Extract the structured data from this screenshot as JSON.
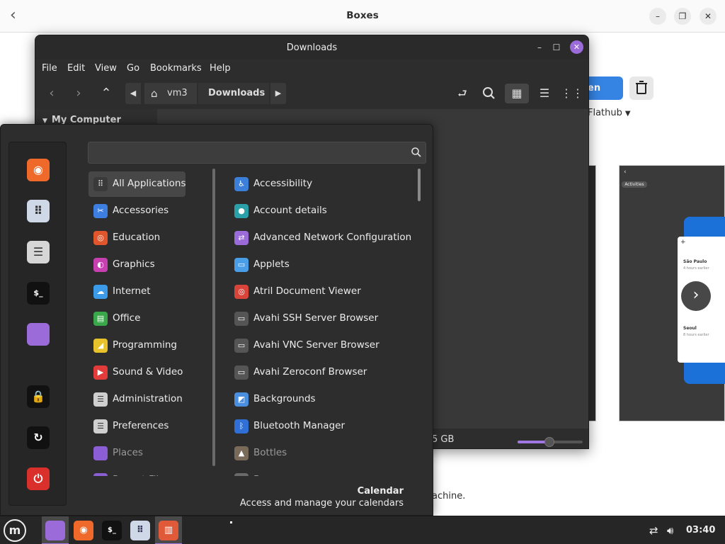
{
  "boxes": {
    "title": "Boxes",
    "open_label": "en",
    "source_label": "Flathub",
    "activities_label": "Activities",
    "city1": "São Paulo",
    "city1_sub": "4 hours earlier",
    "city2": "Seoul",
    "city2_sub": "8 hours earlier",
    "desc_fragment": "achine."
  },
  "nemo": {
    "title": "Downloads",
    "menu": [
      "File",
      "Edit",
      "View",
      "Go",
      "Bookmarks",
      "Help"
    ],
    "breadcrumb": {
      "home": "vm3",
      "current": "Downloads"
    },
    "sidebar_header": "My Computer",
    "status_free": "5 GB",
    "zoom_level": 0.45
  },
  "menu": {
    "search_placeholder": "",
    "categories": [
      {
        "label": "All Applications",
        "icon": "grid-icon",
        "color": "#3a3a3a",
        "glyph": "⠿"
      },
      {
        "label": "Accessories",
        "icon": "scissors-icon",
        "color": "#3d7fe0",
        "glyph": "✂"
      },
      {
        "label": "Education",
        "icon": "education-icon",
        "color": "#e0552b",
        "glyph": "◎"
      },
      {
        "label": "Graphics",
        "icon": "palette-icon",
        "color": "#c83fb0",
        "glyph": "◐"
      },
      {
        "label": "Internet",
        "icon": "cloud-icon",
        "color": "#3b9be8",
        "glyph": "☁"
      },
      {
        "label": "Office",
        "icon": "document-icon",
        "color": "#3aa74a",
        "glyph": "▤"
      },
      {
        "label": "Programming",
        "icon": "code-icon",
        "color": "#e8c22a",
        "glyph": "◢"
      },
      {
        "label": "Sound & Video",
        "icon": "play-icon",
        "color": "#e23b3b",
        "glyph": "▶"
      },
      {
        "label": "Administration",
        "icon": "toggles-icon",
        "color": "#cfcfcf",
        "glyph": "☰"
      },
      {
        "label": "Preferences",
        "icon": "settings-toggle-icon",
        "color": "#cfcfcf",
        "glyph": "☰"
      },
      {
        "label": "Places",
        "icon": "folder-icon",
        "color": "#8b5ed6",
        "glyph": ""
      },
      {
        "label": "Recent Files",
        "icon": "folder-recent-icon",
        "color": "#8b5ed6",
        "glyph": ""
      }
    ],
    "apps": [
      {
        "label": "Accessibility",
        "icon": "accessibility-icon",
        "color": "#3b7fd9",
        "glyph": "♿"
      },
      {
        "label": "Account details",
        "icon": "account-icon",
        "color": "#2aa1a8",
        "glyph": "●"
      },
      {
        "label": "Advanced Network Configuration",
        "icon": "network-icon",
        "color": "#9b6bd9",
        "glyph": "⇄"
      },
      {
        "label": "Applets",
        "icon": "applets-icon",
        "color": "#4a9ee8",
        "glyph": "▭"
      },
      {
        "label": "Atril Document Viewer",
        "icon": "atril-icon",
        "color": "#d9443a",
        "glyph": "◎"
      },
      {
        "label": "Avahi SSH Server Browser",
        "icon": "monitor-icon",
        "color": "#555555",
        "glyph": "▭"
      },
      {
        "label": "Avahi VNC Server Browser",
        "icon": "monitor-icon",
        "color": "#555555",
        "glyph": "▭"
      },
      {
        "label": "Avahi Zeroconf Browser",
        "icon": "monitor-icon",
        "color": "#555555",
        "glyph": "▭"
      },
      {
        "label": "Backgrounds",
        "icon": "backgrounds-icon",
        "color": "#4a8ee0",
        "glyph": "◩"
      },
      {
        "label": "Bluetooth Manager",
        "icon": "bluetooth-icon",
        "color": "#2f6fd6",
        "glyph": "ᛒ"
      },
      {
        "label": "Bottles",
        "icon": "bottles-icon",
        "color": "#7a6a5a",
        "glyph": "▲"
      },
      {
        "label": "Boxes",
        "icon": "boxes-icon",
        "color": "#6a6a6a",
        "glyph": "▣"
      }
    ],
    "description": {
      "title": "Calendar",
      "text": "Access and manage your calendars"
    },
    "favorites": [
      {
        "name": "firefox-icon",
        "color": "#ef6a2a",
        "glyph": "◉"
      },
      {
        "name": "software-manager-icon",
        "color": "#cfd8e6",
        "glyph": "⠿"
      },
      {
        "name": "settings-icon",
        "color": "#d6d6d6",
        "glyph": "☰"
      },
      {
        "name": "terminal-icon",
        "color": "#111111",
        "glyph": "$_"
      },
      {
        "name": "files-icon",
        "color": "#9b6bd9",
        "glyph": ""
      },
      {
        "name": "lock-screen-icon",
        "color": "#111111",
        "glyph": "🔒"
      },
      {
        "name": "logout-icon",
        "color": "#111111",
        "glyph": "↻"
      },
      {
        "name": "shutdown-icon",
        "color": "#d9302b",
        "glyph": "⏻"
      }
    ]
  },
  "panel": {
    "clock": "03:40",
    "apps": [
      {
        "name": "taskbar-files",
        "color": "#9b6bd9",
        "glyph": "",
        "active": true
      },
      {
        "name": "taskbar-firefox",
        "color": "#ef6a2a",
        "glyph": "◉",
        "active": false
      },
      {
        "name": "taskbar-terminal",
        "color": "#111111",
        "glyph": "$_",
        "active": false
      },
      {
        "name": "taskbar-software",
        "color": "#cfd8e6",
        "glyph": "⠿",
        "active": false
      },
      {
        "name": "taskbar-boxes",
        "color": "#e05a3a",
        "glyph": "▥",
        "active": true
      }
    ]
  }
}
